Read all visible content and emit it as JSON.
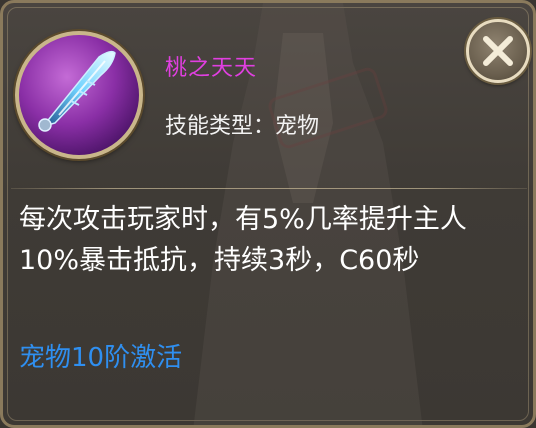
{
  "skill": {
    "name": "桃之天天",
    "type": "技能类型：宠物",
    "description": "每次攻击玩家时，有5%几率提升主人10%暴击抵抗，持续3秒，C60秒",
    "unlock": "宠物10阶激活",
    "icon": "feather-blade-icon"
  },
  "close_icon": "close-icon",
  "colors": {
    "name": "#e03fe0",
    "type": "#f2f2f2",
    "description": "#ffffff",
    "unlock": "#2f8ff0",
    "border": "#8a7a5c",
    "icon_bg": "#8a2fa6"
  }
}
